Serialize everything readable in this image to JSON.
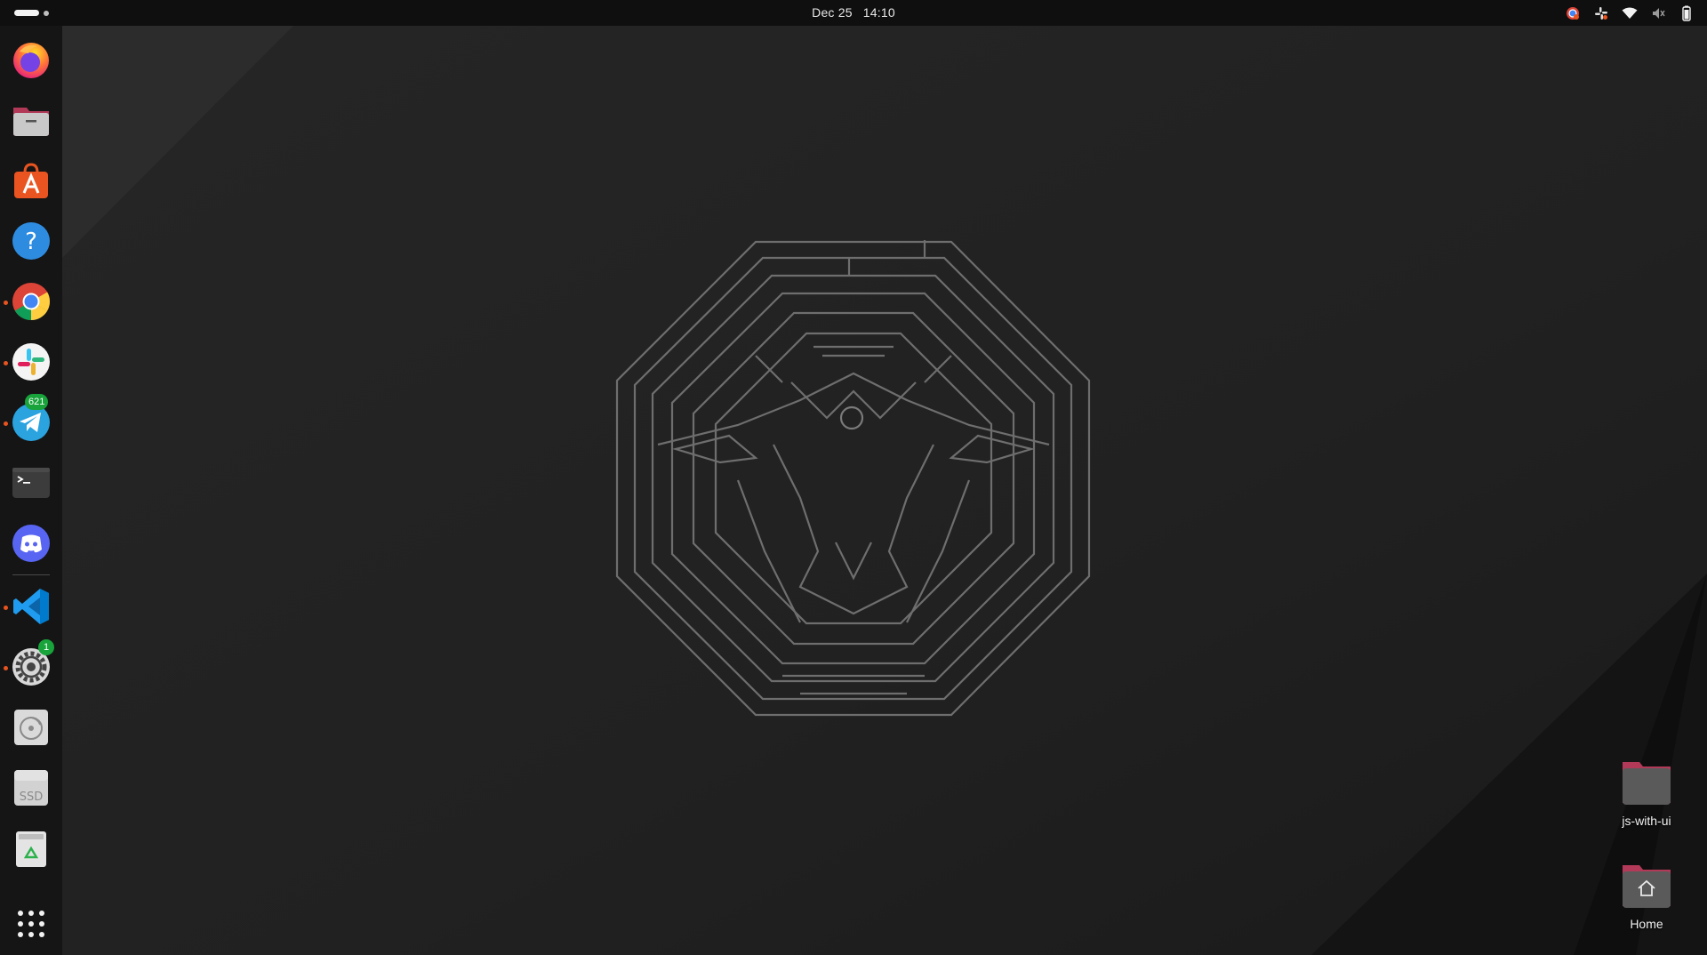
{
  "topbar": {
    "date": "Dec 25",
    "time": "14:10",
    "tray_icons": [
      "chrome-indicator-icon",
      "slack-indicator-icon",
      "wifi-icon",
      "volume-muted-icon",
      "battery-icon"
    ]
  },
  "dock": {
    "items": [
      {
        "name": "firefox",
        "icon": "firefox-icon",
        "running": false
      },
      {
        "name": "files",
        "icon": "files-icon",
        "running": false
      },
      {
        "name": "app-center",
        "icon": "app-center-icon",
        "running": false
      },
      {
        "name": "help",
        "icon": "help-icon",
        "running": false
      },
      {
        "name": "chrome",
        "icon": "chrome-icon",
        "running": true
      },
      {
        "name": "slack",
        "icon": "slack-icon",
        "running": true
      },
      {
        "name": "telegram",
        "icon": "telegram-icon",
        "running": true,
        "badge": "621"
      },
      {
        "name": "terminal",
        "icon": "terminal-icon",
        "running": false
      },
      {
        "name": "discord",
        "icon": "discord-icon",
        "running": false
      },
      {
        "name": "vscode",
        "icon": "vscode-icon",
        "running": true
      },
      {
        "name": "software-updater",
        "icon": "settings-gear-icon",
        "running": true,
        "badge": "1"
      },
      {
        "name": "disc-drive",
        "icon": "optical-disc-icon",
        "running": false
      },
      {
        "name": "ssd-drive",
        "icon": "ssd-drive-icon",
        "running": false,
        "label": "SSD"
      },
      {
        "name": "trash",
        "icon": "trash-icon",
        "running": false
      },
      {
        "name": "show-apps",
        "icon": "app-grid-icon",
        "running": false
      }
    ]
  },
  "desktop_icons": [
    {
      "label": "js-with-ui",
      "icon": "folder-icon"
    },
    {
      "label": "Home",
      "icon": "home-folder-icon"
    }
  ],
  "colors": {
    "topbar": "#0f0f0f",
    "dock": "#151515",
    "wallpaper": "#222222",
    "accent": "#e95420",
    "badge": "#18a33b"
  }
}
